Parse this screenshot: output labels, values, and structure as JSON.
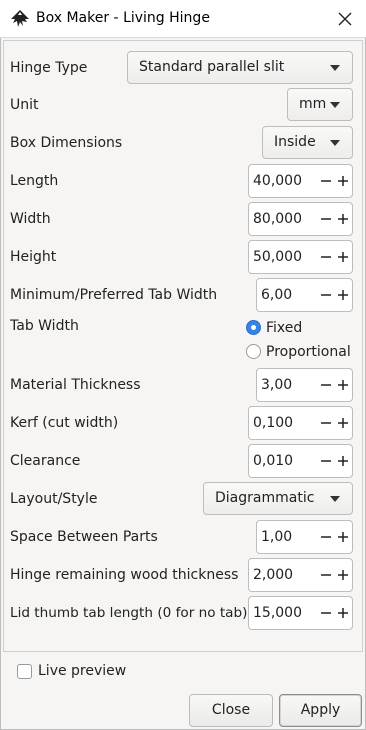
{
  "window": {
    "title": "Box Maker - Living Hinge"
  },
  "fields": {
    "hinge_type": {
      "label": "Hinge Type",
      "value": "Standard parallel slit"
    },
    "unit": {
      "label": "Unit",
      "value": "mm"
    },
    "box_dimensions": {
      "label": "Box Dimensions",
      "value": "Inside"
    },
    "length": {
      "label": "Length",
      "value": "40,000"
    },
    "width": {
      "label": "Width",
      "value": "80,000"
    },
    "height": {
      "label": "Height",
      "value": "50,000"
    },
    "tab_width_min": {
      "label": "Minimum/Preferred Tab Width",
      "value": "6,00"
    },
    "tab_width_mode": {
      "label": "Tab Width",
      "options": [
        "Fixed",
        "Proportional"
      ],
      "selected": "Fixed"
    },
    "material_thickness": {
      "label": "Material Thickness",
      "value": "3,00"
    },
    "kerf": {
      "label": "Kerf (cut width)",
      "value": "0,100"
    },
    "clearance": {
      "label": "Clearance",
      "value": "0,010"
    },
    "layout_style": {
      "label": "Layout/Style",
      "value": "Diagrammatic"
    },
    "space_between_parts": {
      "label": "Space Between Parts",
      "value": "1,00"
    },
    "hinge_remaining_wood": {
      "label": "Hinge remaining wood thickness",
      "value": "2,000"
    },
    "lid_thumb_tab": {
      "label": "Lid thumb tab length (0 for no tab)",
      "value": "15,000"
    }
  },
  "live_preview": {
    "label": "Live preview",
    "checked": false
  },
  "buttons": {
    "close": "Close",
    "apply": "Apply"
  },
  "icons": {
    "app": "inkscape-icon",
    "close": "close-icon",
    "minus": "minus-icon",
    "plus": "plus-icon",
    "dropdown": "chevron-down-icon"
  },
  "colors": {
    "accent": "#3584e4",
    "background": "#f6f5f4"
  }
}
